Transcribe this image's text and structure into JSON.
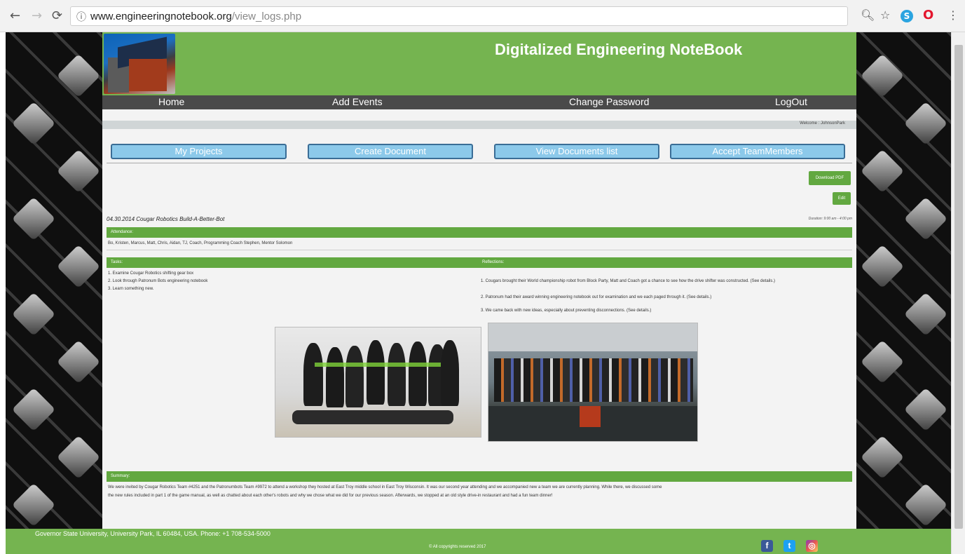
{
  "browser": {
    "url_host": "www.engineeringnotebook.org",
    "url_path": "/view_logs.php",
    "skype_glyph": "S",
    "opera_glyph": "O"
  },
  "site": {
    "title": "Digitalized Engineering NoteBook"
  },
  "nav": {
    "home": "Home",
    "add_events": "Add Events",
    "change_password": "Change Password",
    "logout": "LogOut"
  },
  "welcome": {
    "text": "Welcome : JohnsonPark"
  },
  "actions": {
    "my_projects": "My Projects",
    "create_document": "Create Document",
    "view_documents": "View Documents list",
    "accept_team": "Accept TeamMembers"
  },
  "tools": {
    "download_pdf": "Download PDF",
    "edit": "Edit"
  },
  "event": {
    "title": "04.30.2014 Cougar Robotics Build-A-Better-Bot",
    "duration": "Duration: 9:00 am - 4:00 pm"
  },
  "attendance": {
    "heading": "Attendance:",
    "text": "Bo, Kristen, Marcus, Matt, Chris, Aidan, TJ, Coach, Programming Coach Stephen, Mentor Solomon"
  },
  "tasks": {
    "heading": "Tasks:",
    "items": [
      "1. Examine Cougar Robotics shifting gear box",
      "2. Look through Patronum Bots engineering notebook",
      "3. Learn something new."
    ]
  },
  "reflections": {
    "heading": "Reflections:",
    "items": [
      "1. Cougars brought their World championship robot from Block Party, Matt and Coach got a chance to see how the drive shifter was constructed. (See details.)",
      "2. Patronum had their award winning engineering notebook out for examination and we each paged through it. (See details.)",
      "3. We came back with new ideas, especially about preventing disconnections. (See details.)"
    ]
  },
  "summary": {
    "heading": "Summary:",
    "line1": "We were invited by Cougar Robotics Team #4251 and the Patronumbots Team #9972 to attend a workshop they hosted at East Troy middle school in East Troy Wisconsin. It was our second year attending and we accompanied new a team we are currently planning. While there, we discussed some",
    "line2": "the new rules included in part 1 of the game manual, as well as chatted about each other's robots and why we chose what we did for our previous season. Afterwards, we stopped at an old style drive-in restaurant and had a fun team dinner!"
  },
  "footer": {
    "address": "Governor State University, University Park, IL 60484, USA. Phone: +1 708-534-5000",
    "copyright": "© All copyrights reserved 2017",
    "facebook_glyph": "f",
    "twitter_glyph": "t",
    "instagram_glyph": "◎"
  },
  "colors": {
    "brand_green": "#75b450",
    "nav_dark": "#4a4a4a",
    "button_blue": "#8cc9ea"
  }
}
